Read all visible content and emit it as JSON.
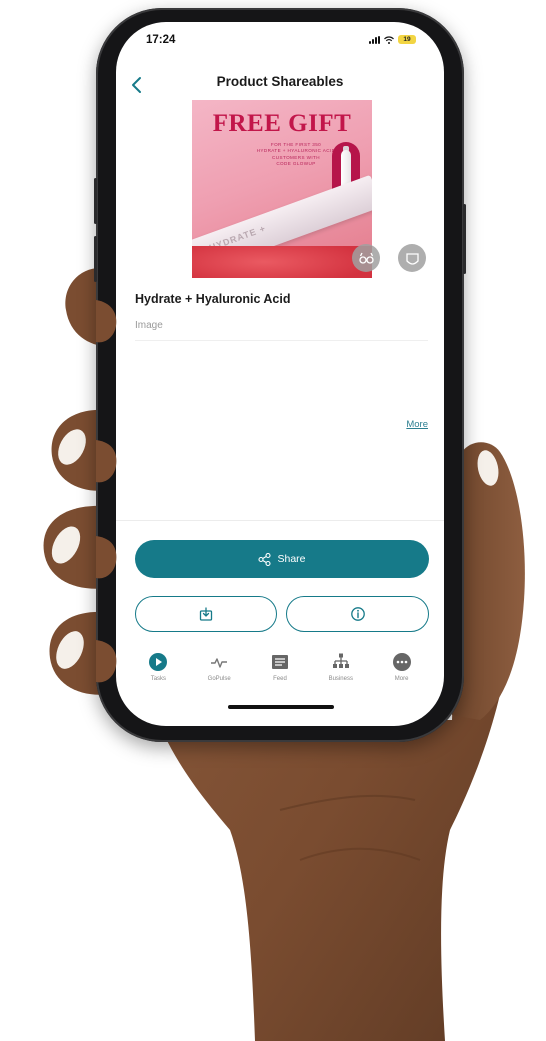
{
  "status_bar": {
    "time": "17:24",
    "battery": "19"
  },
  "header": {
    "title": "Product Shareables",
    "back_icon": "chevron-left-icon"
  },
  "promo_image": {
    "headline": "FREE GIFT",
    "subtext_lines": [
      "FOR THE FIRST 350",
      "HYDRATE + HYALURONIC ACID",
      "CUSTOMERS WITH",
      "CODE GLOWUP"
    ],
    "stick_text": "HYDRATE +",
    "actions": [
      {
        "name": "preview",
        "icon": "glasses-icon"
      },
      {
        "name": "crop",
        "icon": "crop-frame-icon"
      }
    ]
  },
  "product": {
    "name": "Hydrate + Hyaluronic Acid",
    "asset_type": "Image",
    "more_label": "More"
  },
  "actions": {
    "share_label": "Share",
    "share_icon": "share-icon",
    "download_icon": "download-icon",
    "info_icon": "info-icon"
  },
  "nav": {
    "items": [
      {
        "label": "Tasks",
        "icon": "play-circle-icon",
        "active": true
      },
      {
        "label": "GoPulse",
        "icon": "pulse-icon",
        "active": false
      },
      {
        "label": "Feed",
        "icon": "feed-icon",
        "active": false
      },
      {
        "label": "Business",
        "icon": "org-chart-icon",
        "active": false
      },
      {
        "label": "More",
        "icon": "more-dots-icon",
        "active": false
      }
    ]
  },
  "colors": {
    "accent": "#167a89",
    "promo_red": "#c2164a",
    "promo_pink": "#f4b6c6"
  }
}
